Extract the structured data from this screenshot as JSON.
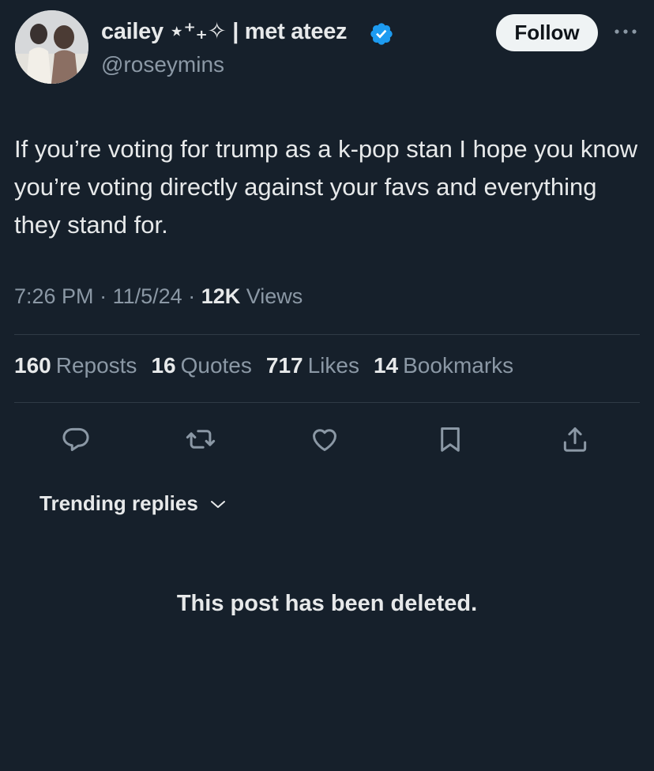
{
  "user": {
    "display_name": "cailey ⋆⁺₊✧ | met ateez",
    "handle": "@roseymins",
    "verified": true
  },
  "header": {
    "follow_label": "Follow",
    "more_icon": "more-horizontal-icon"
  },
  "tweet": {
    "text": "If you’re voting for trump as a k-pop stan I hope you know you’re voting directly against your favs and everything they stand for.",
    "time": "7:26 PM",
    "date": "11/5/24",
    "views_count": "12K",
    "views_label": "Views",
    "separator": "·"
  },
  "stats": [
    {
      "count": "160",
      "label": "Reposts"
    },
    {
      "count": "16",
      "label": "Quotes"
    },
    {
      "count": "717",
      "label": "Likes"
    },
    {
      "count": "14",
      "label": "Bookmarks"
    }
  ],
  "actions": [
    "reply-icon",
    "repost-icon",
    "like-icon",
    "bookmark-icon",
    "share-icon"
  ],
  "replies": {
    "sort_label": "Trending replies",
    "deleted_message": "This post has been deleted."
  },
  "colors": {
    "background": "#16202b",
    "text": "#e7e9ea",
    "secondary": "#8b98a5",
    "verified": "#1d9bf0",
    "divider": "#2f3a45"
  }
}
